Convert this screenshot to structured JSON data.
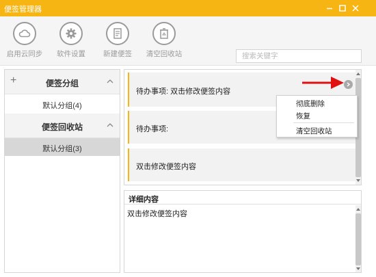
{
  "window": {
    "title": "便签管理器",
    "controls": [
      "minimize-icon",
      "restore-icon",
      "close-icon"
    ],
    "accent_color": "#f6b513"
  },
  "toolbar": {
    "items": [
      {
        "label": "启用云同步",
        "icon": "cloud-icon"
      },
      {
        "label": "软件设置",
        "icon": "gear-icon"
      },
      {
        "label": "新建便签",
        "icon": "new-note-icon"
      },
      {
        "label": "清空回收站",
        "icon": "recycle-bin-icon"
      }
    ],
    "search_placeholder": "搜索关键字"
  },
  "sidebar": {
    "groups": [
      {
        "title": "便签分组",
        "items": [
          {
            "label": "默认分组(4)"
          }
        ]
      },
      {
        "title": "便签回收站",
        "items": [
          {
            "label": "默认分组(3)",
            "selected": true
          }
        ]
      }
    ]
  },
  "notes": [
    {
      "text": "待办事项:   双击修改便签内容"
    },
    {
      "text": "待办事项:"
    },
    {
      "text": "双击修改便签内容"
    }
  ],
  "context_menu": {
    "items": [
      "彻底删除",
      "恢复",
      "清空回收站"
    ]
  },
  "detail": {
    "header": "详细内容",
    "content": "双击修改便签内容"
  }
}
